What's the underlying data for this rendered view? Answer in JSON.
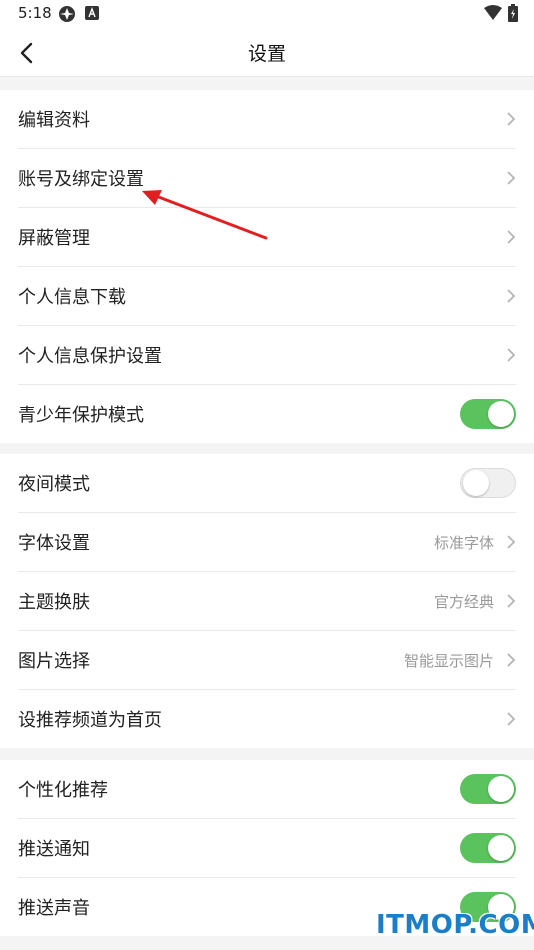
{
  "status_bar": {
    "time": "5:18"
  },
  "nav": {
    "title": "设置"
  },
  "groups": [
    {
      "items": [
        {
          "label": "编辑资料",
          "control": "chevron"
        },
        {
          "label": "账号及绑定设置",
          "control": "chevron"
        },
        {
          "label": "屏蔽管理",
          "control": "chevron"
        },
        {
          "label": "个人信息下载",
          "control": "chevron"
        },
        {
          "label": "个人信息保护设置",
          "control": "chevron"
        },
        {
          "label": "青少年保护模式",
          "control": "toggle",
          "on": true
        }
      ]
    },
    {
      "items": [
        {
          "label": "夜间模式",
          "control": "toggle",
          "on": false
        },
        {
          "label": "字体设置",
          "control": "chevron",
          "value": "标准字体"
        },
        {
          "label": "主题换肤",
          "control": "chevron",
          "value": "官方经典"
        },
        {
          "label": "图片选择",
          "control": "chevron",
          "value": "智能显示图片"
        },
        {
          "label": "设推荐频道为首页",
          "control": "chevron"
        }
      ]
    },
    {
      "items": [
        {
          "label": "个性化推荐",
          "control": "toggle",
          "on": true
        },
        {
          "label": "推送通知",
          "control": "toggle",
          "on": true
        },
        {
          "label": "推送声音",
          "control": "toggle",
          "on": true
        }
      ]
    }
  ],
  "colors": {
    "toggle_on": "#5ac35e",
    "annotation_arrow": "#e02020",
    "watermark": "#1a7fc8"
  },
  "watermark": "ITMOP.COM"
}
